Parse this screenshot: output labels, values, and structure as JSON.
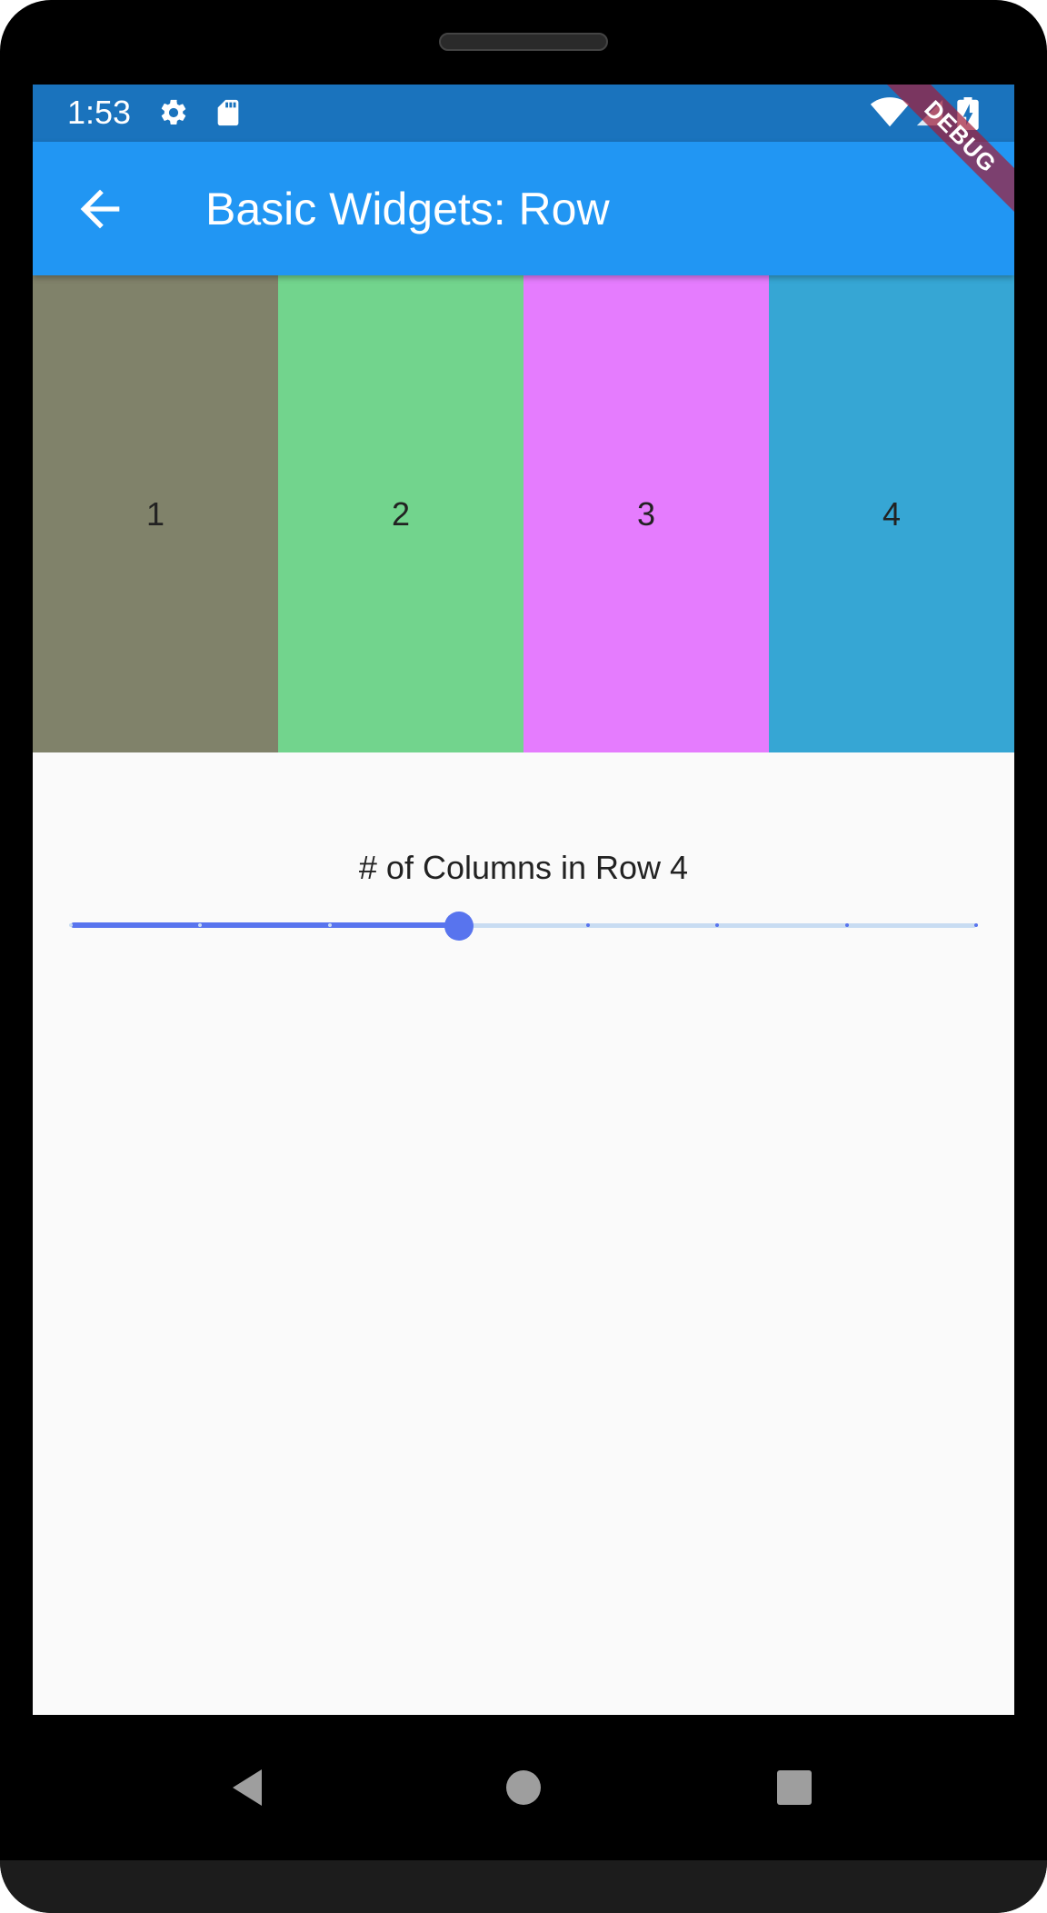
{
  "status_bar": {
    "time": "1:53",
    "icons": [
      "gear-icon",
      "sd-card-icon",
      "wifi-icon",
      "signal-icon",
      "battery-charging-icon"
    ]
  },
  "app_bar": {
    "title": "Basic Widgets: Row",
    "back_icon": "arrow-left-icon",
    "debug_banner": "DEBUG"
  },
  "row": {
    "columns": [
      {
        "label": "1",
        "color": "#80826a"
      },
      {
        "label": "2",
        "color": "#72d48d"
      },
      {
        "label": "3",
        "color": "#e57cfe"
      },
      {
        "label": "4",
        "color": "#36a6d4"
      }
    ]
  },
  "slider": {
    "label": "# of Columns in Row 4",
    "min": 1,
    "max": 8,
    "value": 4,
    "divisions": 7,
    "active_color": "#5874ee",
    "inactive_color": "#c8dcf2"
  },
  "nav_bar": {
    "icons": [
      "back-triangle-icon",
      "home-circle-icon",
      "recents-square-icon"
    ]
  },
  "colors": {
    "app_bar": "#2196f3",
    "status_bar": "#1a73bd",
    "background": "#fafafa"
  }
}
